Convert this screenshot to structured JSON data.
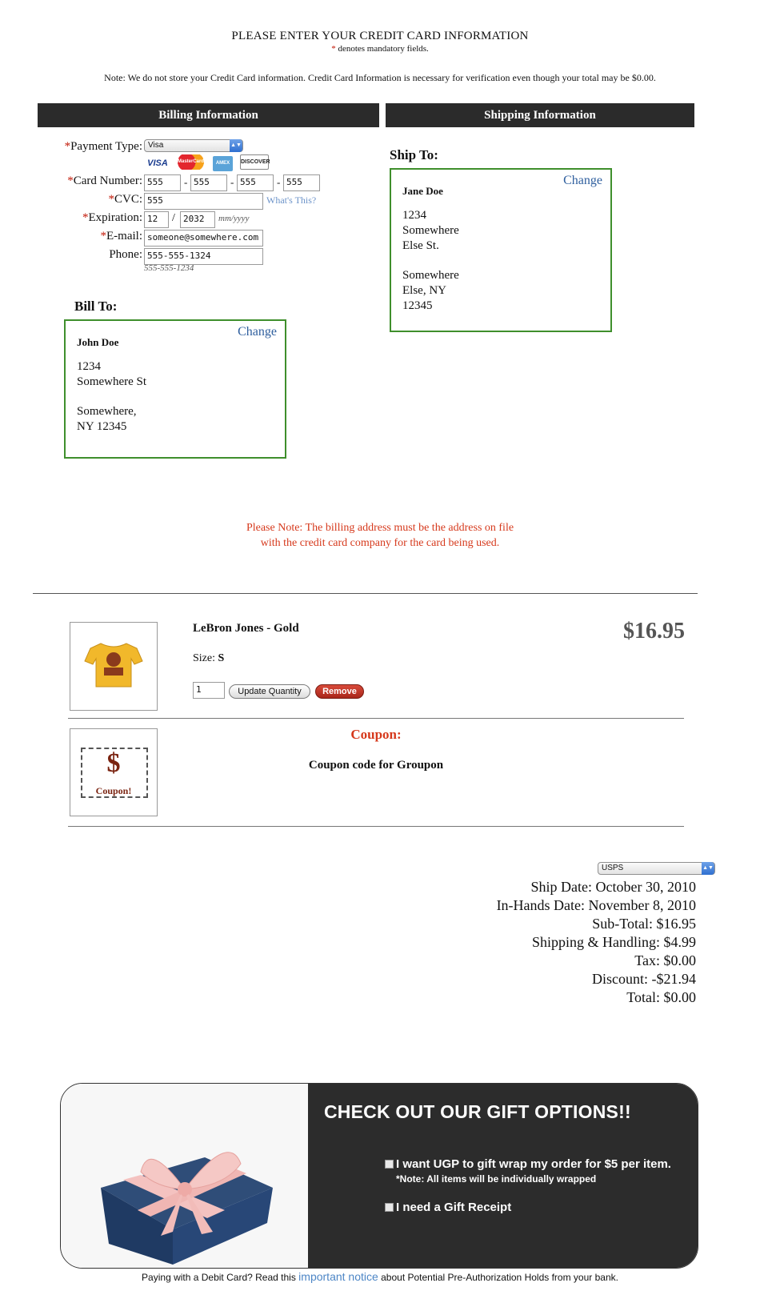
{
  "header": {
    "title": "PLEASE ENTER YOUR CREDIT CARD INFORMATION",
    "mandatory_marker": "*",
    "mandatory_text": "denotes mandatory fields.",
    "note": "Note: We do not store your Credit Card information. Credit Card Information is necessary for verification even though your total may be $0.00."
  },
  "sections": {
    "billing": "Billing Information",
    "shipping": "Shipping Information"
  },
  "form": {
    "payment_type_label": "Payment Type:",
    "payment_type_value": "Visa",
    "card_logos": [
      "VISA",
      "MasterCard",
      "AMEX",
      "DISCOVER"
    ],
    "card_number_label": "Card Number:",
    "card_number_parts": [
      "555",
      "555",
      "555",
      "555"
    ],
    "cvc_label": "CVC:",
    "cvc_value": "555",
    "whats_this": "What's This?",
    "expiration_label": "Expiration:",
    "exp_month": "12",
    "exp_year": "2032",
    "exp_format": "mm/yyyy",
    "email_label": "E-mail:",
    "email_value": "someone@somewhere.com",
    "phone_label": "Phone:",
    "phone_value": "555-555-1324",
    "phone_hint": "555-555-1234",
    "required_marker": "*",
    "slash": "/",
    "dash": "-"
  },
  "bill_to": {
    "heading": "Bill To:",
    "change": "Change",
    "name": "John Doe",
    "line1": "1234",
    "line2": "Somewhere St",
    "line3": "Somewhere,",
    "line4": "NY 12345"
  },
  "ship_to": {
    "heading": "Ship To:",
    "change": "Change",
    "name": "Jane Doe",
    "line1": "1234",
    "line2": "Somewhere",
    "line3": "Else St.",
    "line4": "Somewhere",
    "line5": "Else, NY",
    "line6": "12345"
  },
  "billing_note": {
    "line1": "Please Note: The billing address must be the address on file",
    "line2": "with the credit card company for the card being used."
  },
  "cart_item": {
    "name": "LeBron Jones - Gold",
    "size_label": "Size:",
    "size_value": "S",
    "quantity": "1",
    "update_button": "Update Quantity",
    "remove_button": "Remove",
    "price": "$16.95"
  },
  "coupon": {
    "heading": "Coupon:",
    "text": "Coupon code for Groupon",
    "image_text": "Coupon!"
  },
  "shipping_method": "USPS",
  "totals": {
    "ship_date": "Ship Date: October 30, 2010",
    "in_hands_date": "In-Hands Date: November 8, 2010",
    "sub_total": "Sub-Total: $16.95",
    "shipping_handling": "Shipping & Handling: $4.99",
    "tax": "Tax: $0.00",
    "discount": "Discount: -$21.94",
    "total": "Total: $0.00"
  },
  "gift": {
    "title": "CHECK OUT OUR GIFT OPTIONS!!",
    "option1": "I want UGP to gift wrap my order for $5 per item.",
    "option1_note": "*Note: All items will be individually wrapped",
    "option2": "I need a Gift Receipt"
  },
  "footer": {
    "before": "Paying with a Debit Card? Read this",
    "link": "important notice",
    "after": "about Potential Pre-Authorization Holds from your bank."
  },
  "colors": {
    "accent_green": "#3f8f2c",
    "link_blue": "#2f5f9e",
    "warning_red": "#d6391c",
    "bar_dark": "#2b2b2b"
  }
}
